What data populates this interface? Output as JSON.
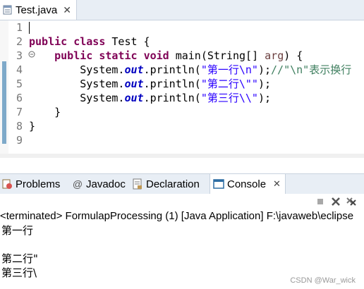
{
  "editor": {
    "tab_label": "Test.java",
    "line_numbers": [
      "1",
      "2",
      "3",
      "4",
      "5",
      "6",
      "7",
      "8",
      "9"
    ],
    "lines": {
      "l2": {
        "kw1": "public",
        "kw2": "class",
        "rest": " Test {"
      },
      "l3": {
        "kw1": "public",
        "kw2": "static",
        "kw3": "void",
        "mid": " main(String[] ",
        "param": "arg",
        "end": ") {"
      },
      "l4": {
        "pre": "System.",
        "field": "out",
        "mid": ".println(",
        "str": "\"第一行\\n\"",
        "semi": ");",
        "comment": "//\"\\n\"表示换行"
      },
      "l5": {
        "pre": "System.",
        "field": "out",
        "mid": ".println(",
        "str": "\"第二行\\\"\"",
        "semi": ");"
      },
      "l6": {
        "pre": "System.",
        "field": "out",
        "mid": ".println(",
        "str": "\"第三行\\\\\"",
        "semi": ");"
      },
      "l7": {
        "text": "}"
      },
      "l8": {
        "text": "}"
      }
    }
  },
  "panel": {
    "tabs": [
      "Problems",
      "Javadoc",
      "Declaration",
      "Console"
    ],
    "close_glyph": "✕",
    "console_status": "<terminated> FormulapProcessing (1) [Java Application] F:\\javaweb\\eclipse",
    "console_lines": [
      "第一行",
      "",
      "第二行\"",
      "第三行\\"
    ]
  },
  "watermark": "CSDN @War_wick"
}
